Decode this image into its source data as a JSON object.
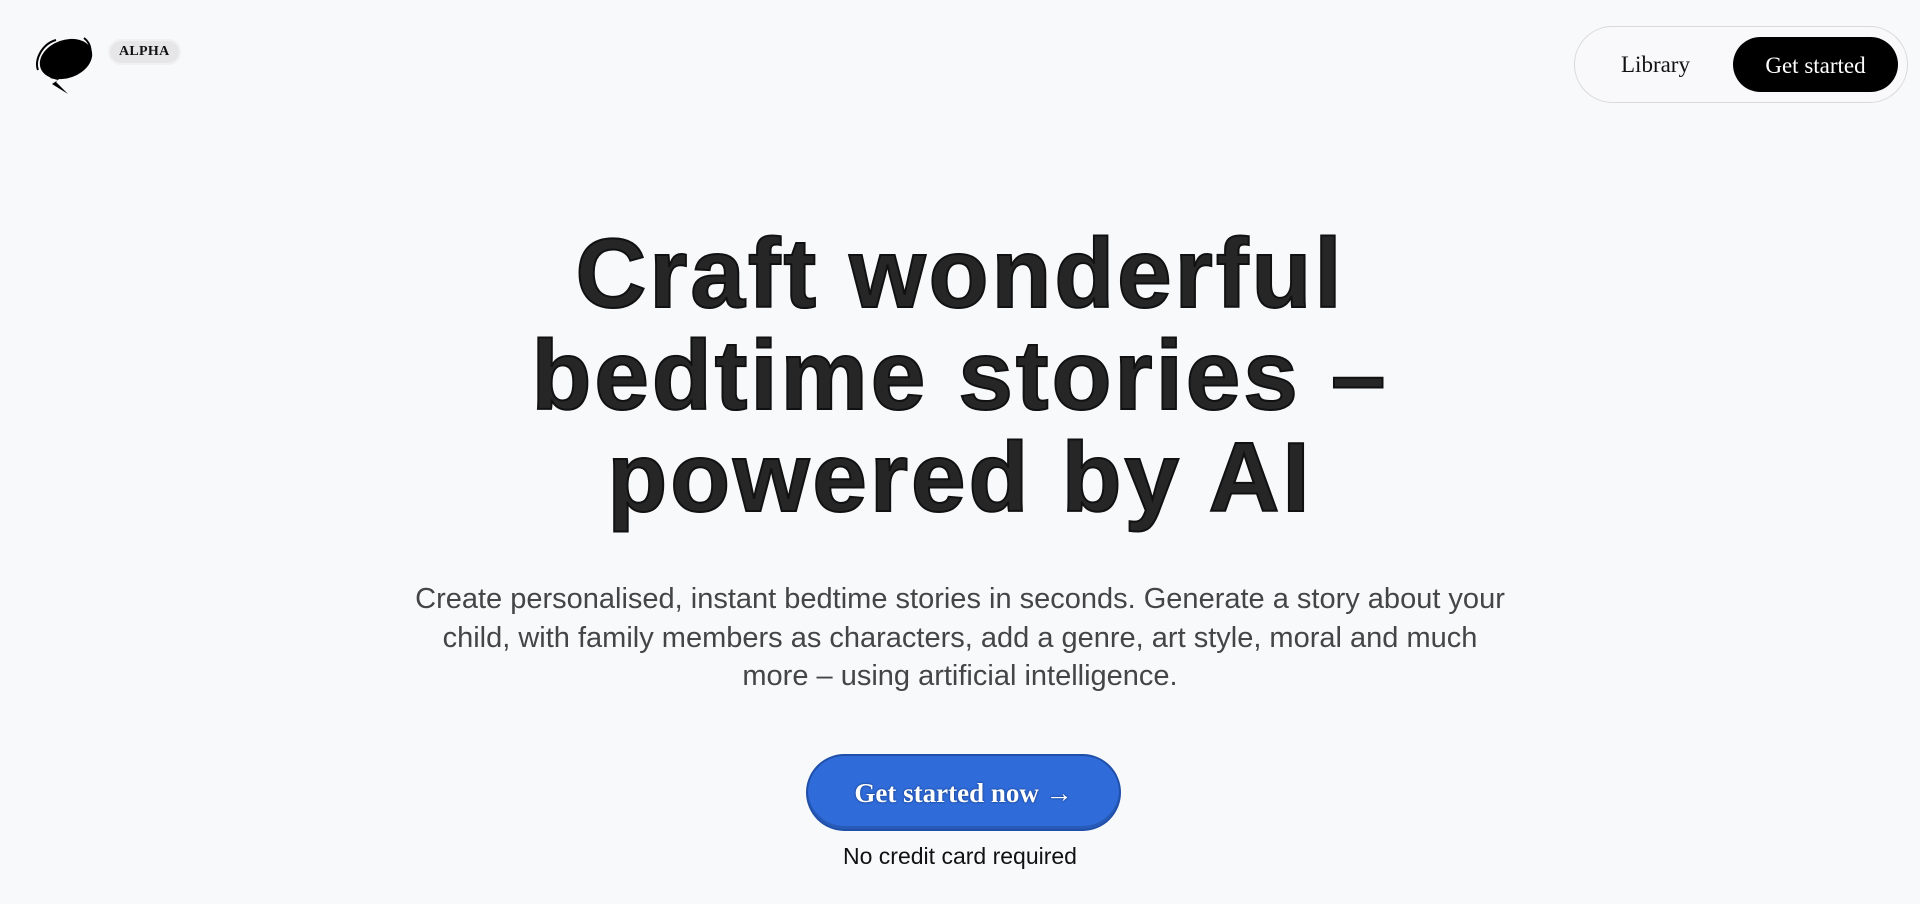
{
  "header": {
    "logo_icon": "speech-bubble-lightning-icon",
    "badge": "ALPHA",
    "nav": {
      "library_label": "Library",
      "get_started_label": "Get started"
    }
  },
  "hero": {
    "title_lines": [
      "Craft wonderful",
      "bedtime stories –",
      "powered by AI"
    ],
    "subtitle_lines": [
      "Create personalised, instant bedtime stories in seconds. Generate a story about your",
      "child, with family members as characters, add a genre, art style, moral and much",
      "more – using artificial intelligence."
    ],
    "cta_label": "Get started now →",
    "cta_note": "No credit card required"
  },
  "colors": {
    "background": "#f8f9fb",
    "cta_blue": "#2f6bd9",
    "nav_button": "#000000",
    "heading": "#262626",
    "subtitle": "#454545"
  }
}
